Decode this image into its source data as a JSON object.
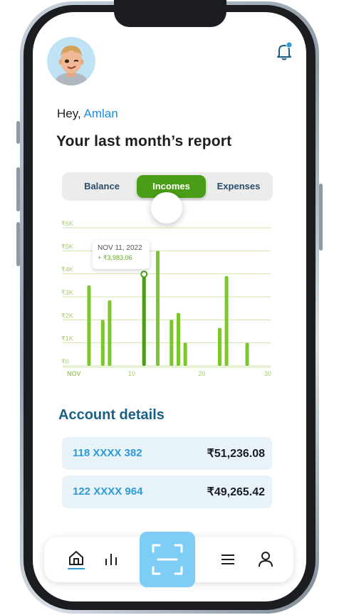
{
  "header": {
    "greeting_prefix": "Hey,",
    "user_name": "Amlan",
    "report_title": "Your last month’s report",
    "notification_icon": "bell-icon",
    "notification_dot_color": "#2d9ad6"
  },
  "tabs": [
    {
      "label": "Balance"
    },
    {
      "label": "Incomes"
    },
    {
      "label": "Expenses"
    }
  ],
  "active_tab": "Incomes",
  "chart_data": {
    "type": "bar",
    "y_tick_labels": [
      "₹6K",
      "₹5K",
      "₹4K",
      "₹3K",
      "₹2K",
      "₹1K",
      "₹0"
    ],
    "x_tick_labels": [
      "NOV",
      "10",
      "20",
      "30"
    ],
    "ylim": [
      0,
      6000
    ],
    "xlim": [
      1,
      30
    ],
    "grid": true,
    "bar_color": "#7bc62a",
    "highlight_color": "#4a9d16",
    "x": [
      4,
      6,
      7,
      12,
      14,
      16,
      17,
      18,
      23,
      24,
      27
    ],
    "values": [
      3500,
      2000,
      2850,
      3983.06,
      5000,
      2000,
      2300,
      1000,
      1650,
      3900,
      1000
    ],
    "highlight_index": 3,
    "tooltip": {
      "date": "NOV 11, 2022",
      "value": "+ ₹3,983.06"
    }
  },
  "accounts": {
    "title": "Account details",
    "items": [
      {
        "number": "118 XXXX 382",
        "balance": "₹51,236.08"
      },
      {
        "number": "122 XXXX 964",
        "balance": "₹49,265.42"
      }
    ]
  },
  "nav": {
    "items": [
      "home-icon",
      "stats-icon",
      "scan-icon",
      "menu-icon",
      "profile-icon"
    ],
    "accent": "#7dcdf6"
  }
}
